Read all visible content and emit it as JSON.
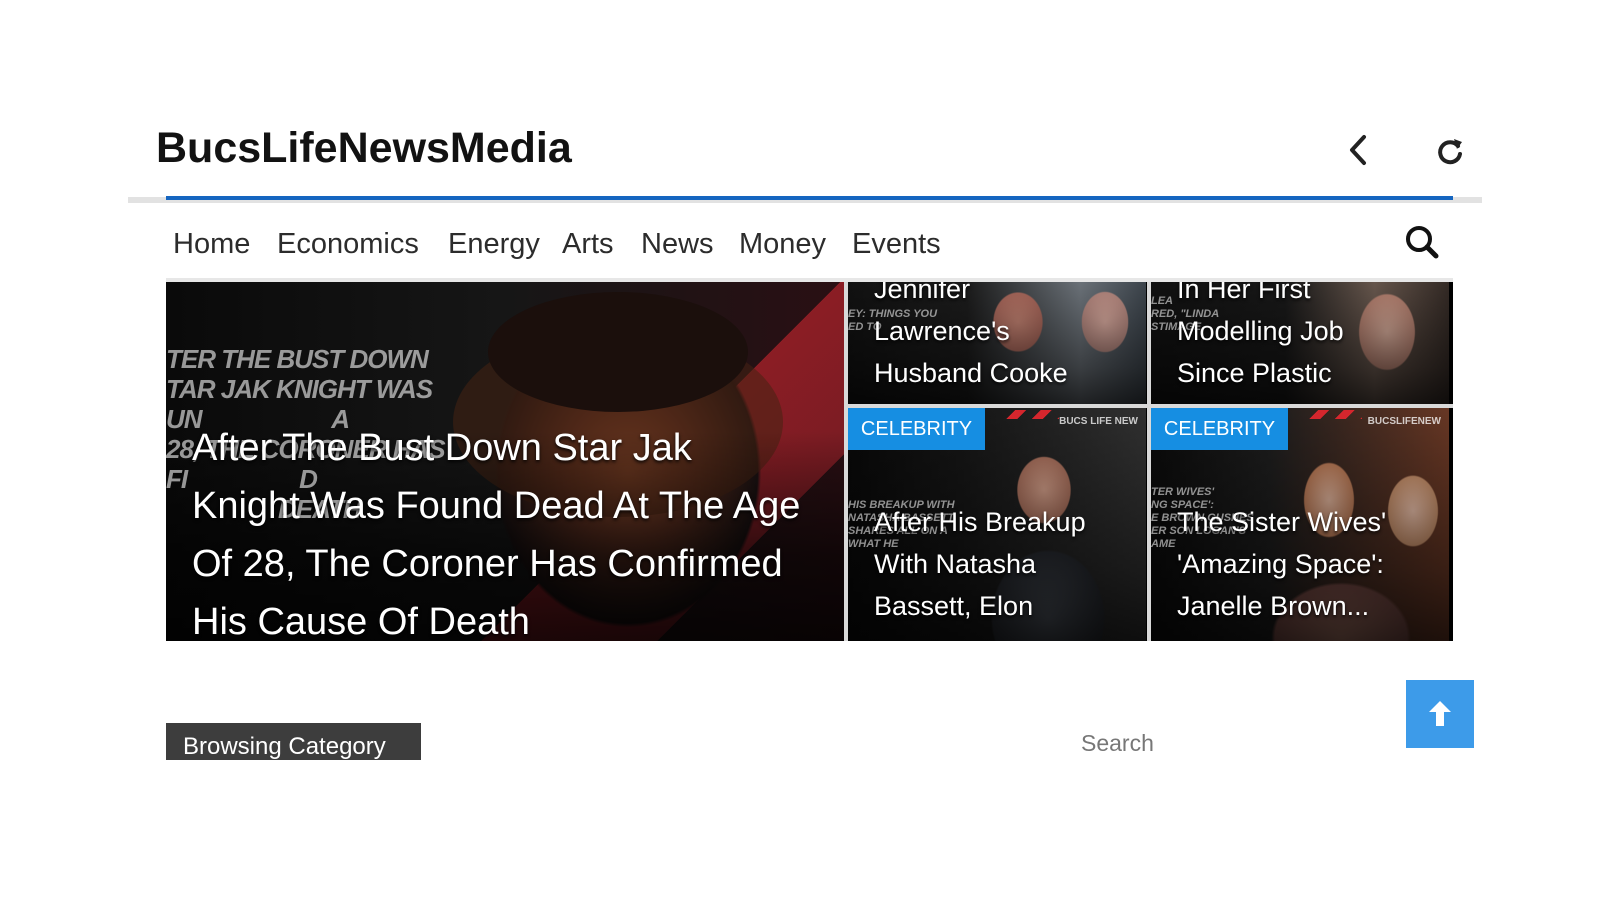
{
  "header": {
    "title": "BucsLifeNewsMedia",
    "icons": {
      "back": "chevron-left-icon",
      "refresh": "refresh-icon",
      "search": "search-icon"
    }
  },
  "nav": {
    "items": [
      {
        "label": "Home"
      },
      {
        "label": "Economics"
      },
      {
        "label": "Energy"
      },
      {
        "label": "Arts"
      },
      {
        "label": "News"
      },
      {
        "label": "Money"
      },
      {
        "label": "Events"
      }
    ]
  },
  "featured": {
    "main": {
      "background_text": "TER THE BUST DOWN\nTAR JAK KNIGHT WAS\nUN                     A\n28, THE CORONER HAS\nFI                  D\n                  DEATH",
      "title": "After The Bust Down Star Jak Knight Was Found Dead At The Age Of 28, The Coroner Has Confirmed His Cause Of Death"
    },
    "cards": [
      {
        "title": "Jennifer\nLawrence's\nHusband Cooke",
        "background_text": "\n\nEY: THINGS YOU\nED TO",
        "category": ""
      },
      {
        "title": "In Her First\nModelling Job\nSince Plastic",
        "background_text": "\nLEA\nRED, \"LINDA\nSTIMAGE",
        "category": ""
      },
      {
        "title": "After His Breakup\nWith Natasha\nBassett, Elon",
        "background_text": "\n\n\n\n\n\n\nHIS BREAKUP WITH\nNATASHA BASSETT\nSHARES ALL ON A\nWHAT HE",
        "category": "CELEBRITY",
        "brand": "BUCS LIFE NEW"
      },
      {
        "title": "The Sister Wives'\n'Amazing Space':\nJanelle Brown...",
        "background_text": "\n\n\n\n\n\nTER WIVES'\nNG SPACE':\nE BROWN GUSHES\nER SON LOGAN'S\nAME",
        "category": "CELEBRITY",
        "brand": "BUCSLIFENEW"
      }
    ]
  },
  "footer": {
    "browsing_label": "Browsing Category",
    "search_label": "Search"
  },
  "colors": {
    "accent": "#1565c0",
    "badge": "#168ee2",
    "scroll_button": "#3d9be9",
    "browsing_bg": "#3d3d3d"
  }
}
